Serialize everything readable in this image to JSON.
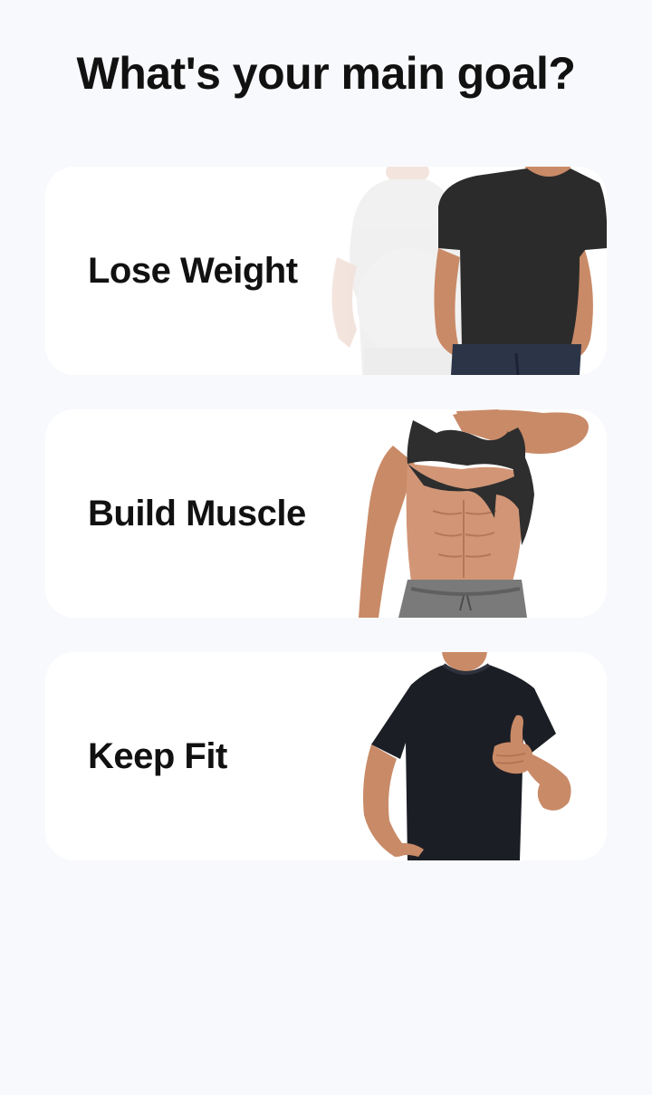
{
  "header": {
    "title": "What's your main goal?"
  },
  "goals": [
    {
      "label": "Lose Weight",
      "image": "before-after-fitness-illustration"
    },
    {
      "label": "Build Muscle",
      "image": "abs-muscle-illustration"
    },
    {
      "label": "Keep Fit",
      "image": "thumbs-up-fitness-illustration"
    }
  ],
  "colors": {
    "background": "#f8f9fc",
    "card": "#ffffff",
    "text": "#111111",
    "shirt": "#2b2b2b",
    "skin": "#c98a67"
  }
}
